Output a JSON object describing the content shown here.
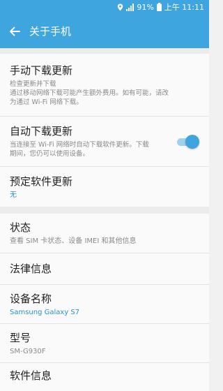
{
  "status_bar": {
    "battery": "91%",
    "time": "上午 11:11"
  },
  "header": {
    "title": "关于手机"
  },
  "updates": {
    "manual": {
      "title": "手动下载更新",
      "subtitle_1": "检查更新并下载",
      "subtitle_2": "通过移动网络下载可能产生额外费用。如有可能，请改",
      "subtitle_3": "为通过 Wi-Fi 网络下载。"
    },
    "auto": {
      "title": "自动下载更新",
      "subtitle_1": "当连接至 Wi-Fi 网络时自动下载软件更新。下载",
      "subtitle_2": "期间，您仍可以使用设备。",
      "enabled": true
    },
    "scheduled": {
      "title": "预定软件更新",
      "value": "无"
    }
  },
  "info": {
    "status": {
      "title": "状态",
      "subtitle": "查看 SIM 卡状态、设备 IMEI 和其他信息"
    },
    "legal": {
      "title": "法律信息"
    },
    "device_name": {
      "title": "设备名称",
      "value": "Samsung Galaxy S7"
    },
    "model": {
      "title": "型号",
      "value": "SM-G930F"
    },
    "software": {
      "title": "软件信息"
    }
  },
  "colors": {
    "accent": "#3ea5de",
    "link": "#2d8fcf",
    "background": "#f1f1f1"
  },
  "icons": [
    "location-icon",
    "signal-icon",
    "battery-icon",
    "back-arrow-icon"
  ]
}
